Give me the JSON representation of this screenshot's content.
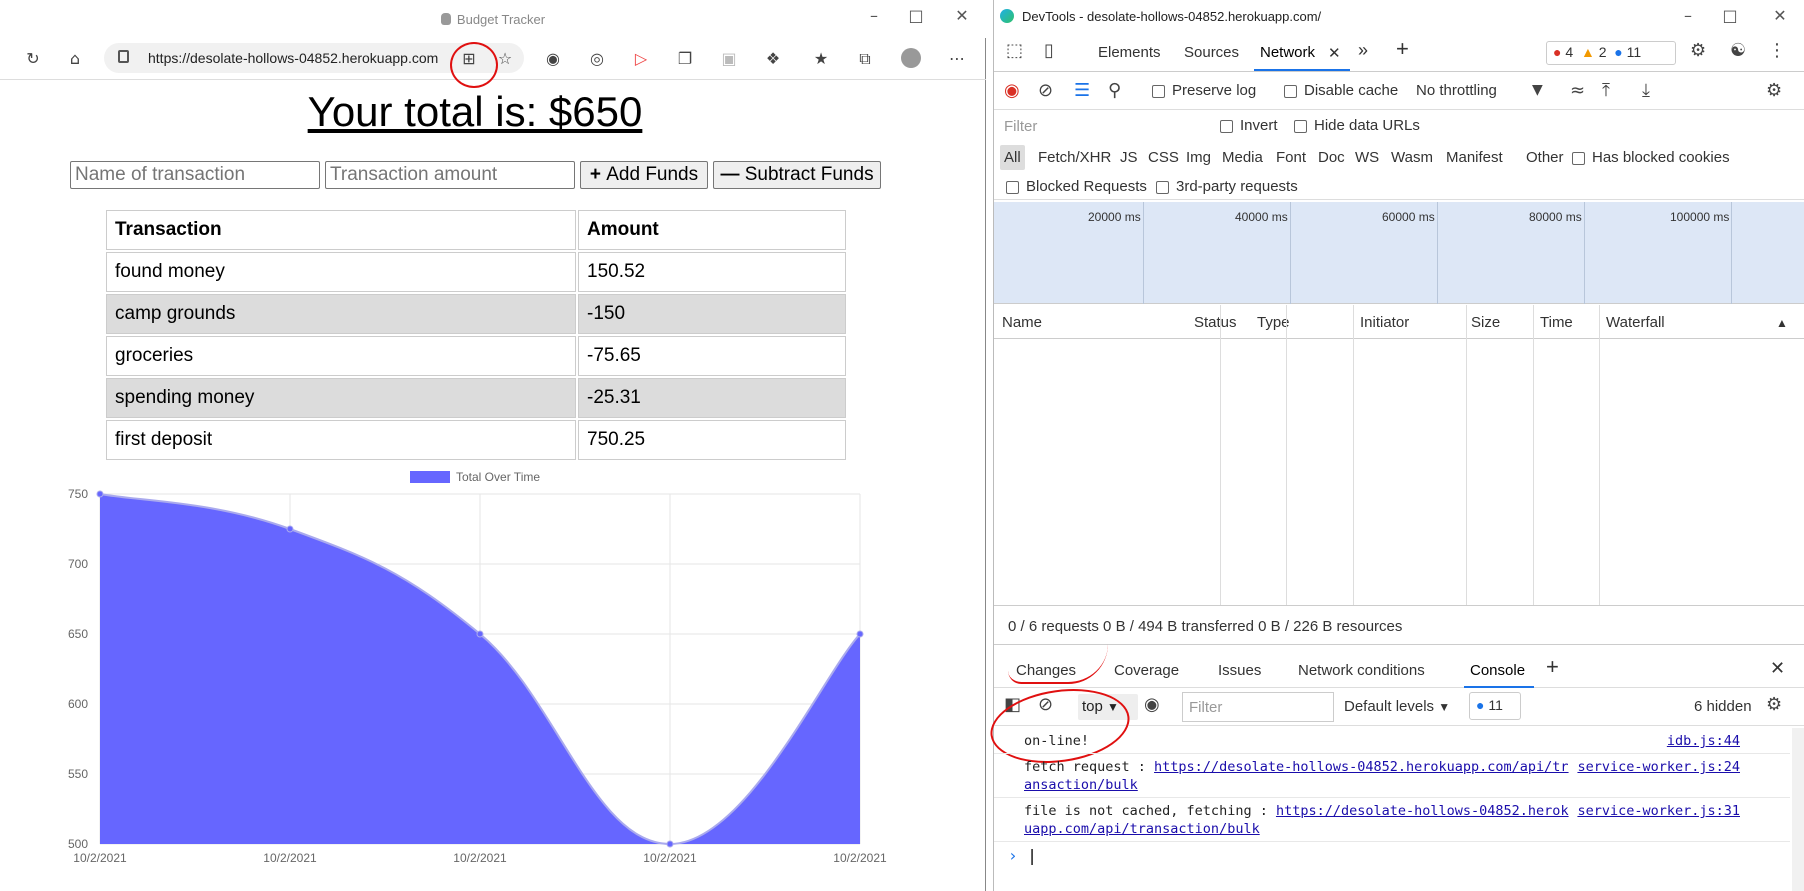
{
  "browser": {
    "window_title": "Budget Tracker",
    "url": "https://desolate-hollows-04852.herokuapp.com"
  },
  "app": {
    "total_label": "Your total is: $650",
    "name_placeholder": "Name of transaction",
    "amount_placeholder": "Transaction amount",
    "add_label": "Add Funds",
    "subtract_label": "Subtract Funds",
    "table_headers": [
      "Transaction",
      "Amount"
    ],
    "transactions": [
      {
        "name": "found money",
        "amount": "150.52"
      },
      {
        "name": "camp grounds",
        "amount": "-150"
      },
      {
        "name": "groceries",
        "amount": "-75.65"
      },
      {
        "name": "spending money",
        "amount": "-25.31"
      },
      {
        "name": "first deposit",
        "amount": "750.25"
      }
    ]
  },
  "chart_data": {
    "type": "area",
    "x": [
      "10/2/2021",
      "10/2/2021",
      "10/2/2021",
      "10/2/2021",
      "10/2/2021"
    ],
    "series": [
      {
        "name": "Total Over Time",
        "values": [
          750,
          725,
          650,
          500,
          650
        ],
        "color": "#6666ff"
      }
    ],
    "ylim": [
      500,
      750
    ],
    "yticks": [
      750,
      700,
      650,
      600,
      550,
      500
    ],
    "grid": true,
    "legend": "top-center"
  },
  "devtools": {
    "window_title": "DevTools - desolate-hollows-04852.herokuapp.com/",
    "tabs": [
      "Elements",
      "Sources",
      "Network"
    ],
    "errors": "4",
    "warnings": "2",
    "messages": "11",
    "net_toolbar": {
      "preserve_log": "Preserve log",
      "disable_cache": "Disable cache",
      "throttling": "No throttling"
    },
    "filter_placeholder": "Filter",
    "invert": "Invert",
    "hide_data_urls": "Hide data URLs",
    "types": [
      "All",
      "Fetch/XHR",
      "JS",
      "CSS",
      "Img",
      "Media",
      "Font",
      "Doc",
      "WS",
      "Wasm",
      "Manifest",
      "Other"
    ],
    "has_blocked_cookies": "Has blocked cookies",
    "blocked_requests": "Blocked Requests",
    "third_party": "3rd-party requests",
    "timeline_labels": [
      "20000 ms",
      "40000 ms",
      "60000 ms",
      "80000 ms",
      "100000 ms"
    ],
    "columns": [
      "Name",
      "Status",
      "Type",
      "Initiator",
      "Size",
      "Time",
      "Waterfall"
    ],
    "summary": "0 / 6 requests  0 B / 494 B transferred  0 B / 226 B resources",
    "drawer_tabs": [
      "Changes",
      "Coverage",
      "Issues",
      "Network conditions",
      "Console"
    ],
    "context": "top",
    "console_filter": "Filter",
    "levels": "Default levels",
    "console_count": "11",
    "hidden": "6 hidden",
    "logs": [
      {
        "line1": "on-line!",
        "source": "idb.js:44"
      },
      {
        "prefix": "fetch request : ",
        "link1": "https://desolate-hollows-04852.herokuapp.com/api/tr",
        "link2": "ansaction/bulk",
        "source": "service-worker.js:24"
      },
      {
        "prefix": "file is not cached, fetching : ",
        "link1": "https://desolate-hollows-04852.herok",
        "link2": "uapp.com/api/transaction/bulk",
        "source": "service-worker.js:31"
      }
    ]
  }
}
